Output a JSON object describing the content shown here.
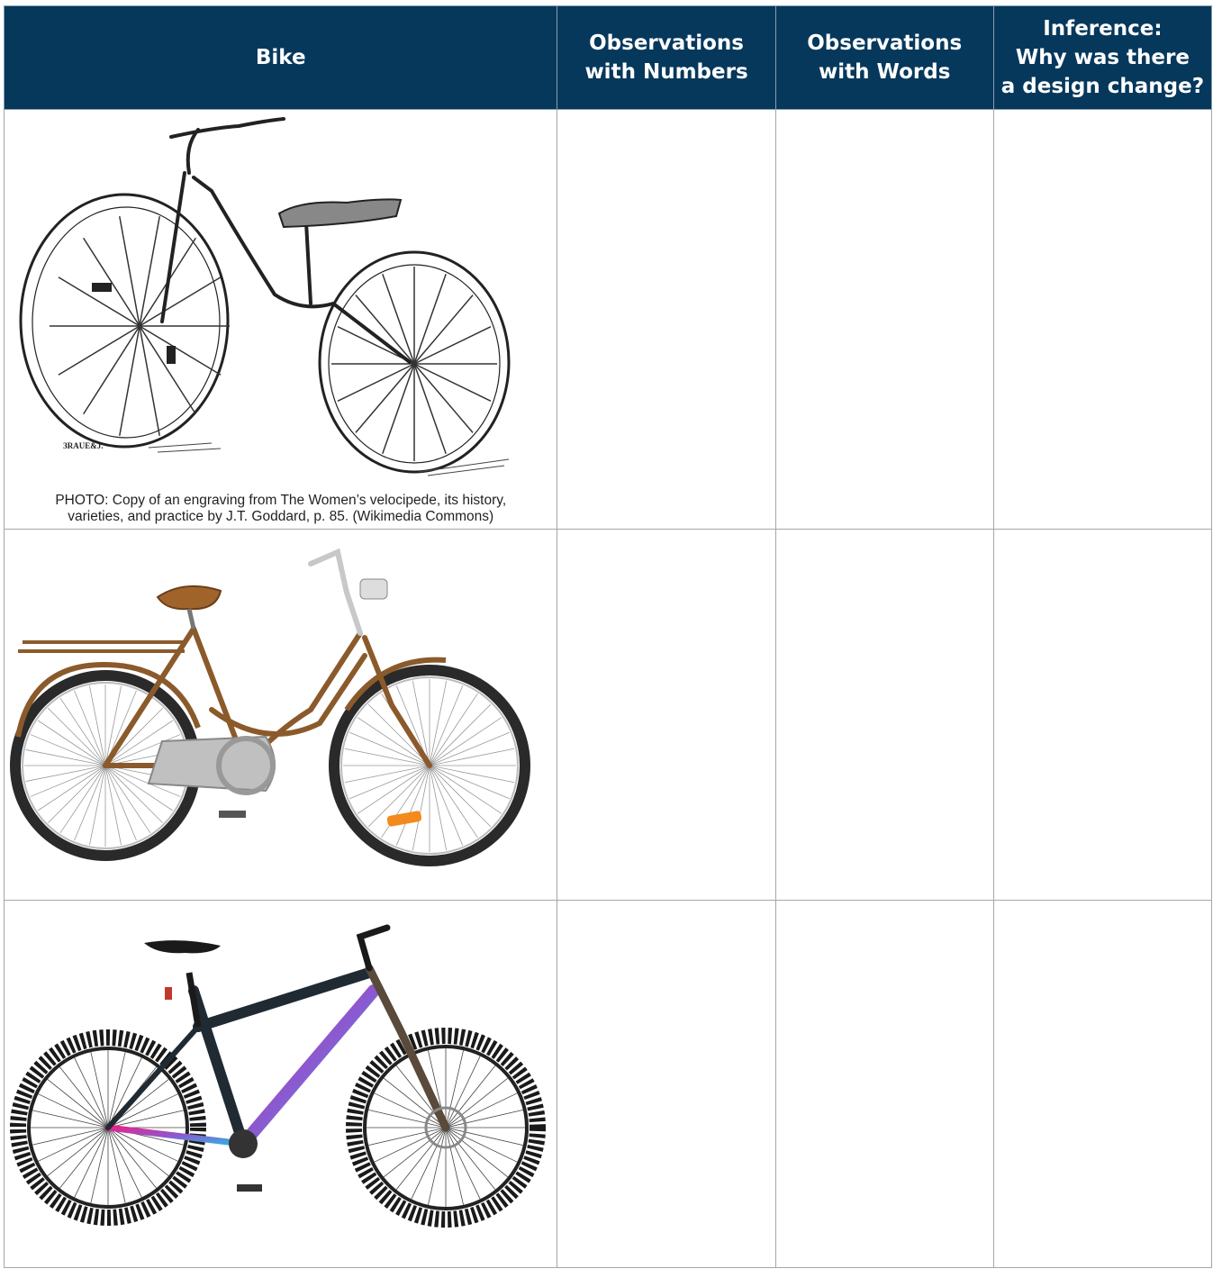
{
  "header": {
    "columns": [
      {
        "lines": [
          "Bike"
        ]
      },
      {
        "lines": [
          "Observations",
          "with Numbers"
        ]
      },
      {
        "lines": [
          "Observations",
          "with Words"
        ]
      },
      {
        "lines": [
          "Inference:",
          "Why was there",
          "a design change?"
        ]
      }
    ]
  },
  "rows": [
    {
      "image_icon": "velocipede-engraving-icon",
      "engraver_signature": "ЗRAUE&J.",
      "caption_lines": [
        "PHOTO: Copy of an engraving from The Women’s velocipede, its history,",
        "varieties, and practice by J.T. Goddard, p. 85. (Wikimedia Commons)"
      ]
    },
    {
      "image_icon": "vintage-step-through-bicycle-icon"
    },
    {
      "image_icon": "mountain-bike-icon"
    }
  ],
  "colors": {
    "header_bg": "#06385c",
    "header_text": "#ffffff",
    "grid_line": "#a6a6a6",
    "vintage_frame": "#8b5a2b",
    "mtb_frame": "#1f2a33",
    "mtb_accent_pink": "#e8238a",
    "mtb_accent_cyan": "#2bb7e0"
  }
}
